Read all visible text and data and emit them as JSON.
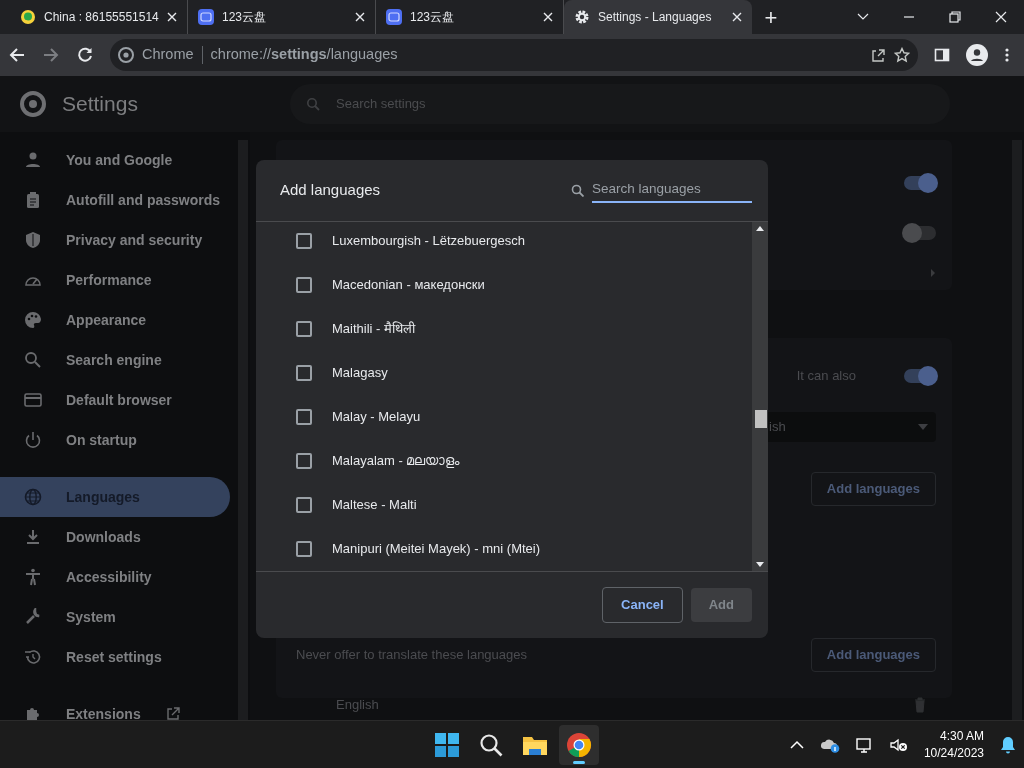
{
  "browser": {
    "tabs": [
      {
        "title": "China : 86155551514",
        "selected": false,
        "kind": "chat"
      },
      {
        "title": "123云盘",
        "selected": false,
        "kind": "app"
      },
      {
        "title": "123云盘",
        "selected": false,
        "kind": "app"
      },
      {
        "title": "Settings - Languages",
        "selected": true,
        "kind": "settings"
      }
    ],
    "new_tab": "+",
    "address": {
      "chip": "Chrome",
      "url": "chrome://**settings**/languages"
    }
  },
  "settings": {
    "title": "Settings",
    "search": {
      "placeholder": "Search settings"
    },
    "sidebar": [
      {
        "label": "You and Google",
        "selected": false
      },
      {
        "label": "Autofill and passwords",
        "selected": false
      },
      {
        "label": "Privacy and security",
        "selected": false
      },
      {
        "label": "Performance",
        "selected": false
      },
      {
        "label": "Appearance",
        "selected": false
      },
      {
        "label": "Search engine",
        "selected": false
      },
      {
        "label": "Default browser",
        "selected": false
      },
      {
        "label": "On startup",
        "selected": false
      },
      {
        "label": "Languages",
        "selected": true
      },
      {
        "label": "Downloads",
        "selected": false
      },
      {
        "label": "Accessibility",
        "selected": false
      },
      {
        "label": "System",
        "selected": false
      },
      {
        "label": "Reset settings",
        "selected": false
      },
      {
        "label": "Extensions",
        "selected": false
      }
    ],
    "content": {
      "top_toggles": [
        {
          "on": true
        },
        {
          "on": false
        }
      ],
      "spell_text": "It can also",
      "spell_toggle": {
        "on": true
      },
      "dropdown_value": "ish",
      "add_button_1": "Add languages",
      "never_translate_label": "Never offer to translate these languages",
      "add_button_2": "Add languages",
      "never_translate_items": [
        "English"
      ]
    }
  },
  "dialog": {
    "title": "Add languages",
    "search": {
      "placeholder": "Search languages"
    },
    "languages": [
      {
        "label": "Luxembourgish - Lëtzebuergesch",
        "checked": false
      },
      {
        "label": "Macedonian - македонски",
        "checked": false
      },
      {
        "label": "Maithili - मैथिली",
        "checked": false
      },
      {
        "label": "Malagasy",
        "checked": false
      },
      {
        "label": "Malay - Melayu",
        "checked": false
      },
      {
        "label": "Malayalam - മലയാളം",
        "checked": false
      },
      {
        "label": "Maltese - Malti",
        "checked": false
      },
      {
        "label": "Manipuri (Meitei Mayek) - mni (Mtei)",
        "checked": false
      }
    ],
    "cancel": {
      "label": "Cancel",
      "disabled": false
    },
    "add": {
      "label": "Add",
      "disabled": true
    }
  },
  "taskbar": {
    "time": "4:30 AM",
    "date": "10/24/2023"
  }
}
